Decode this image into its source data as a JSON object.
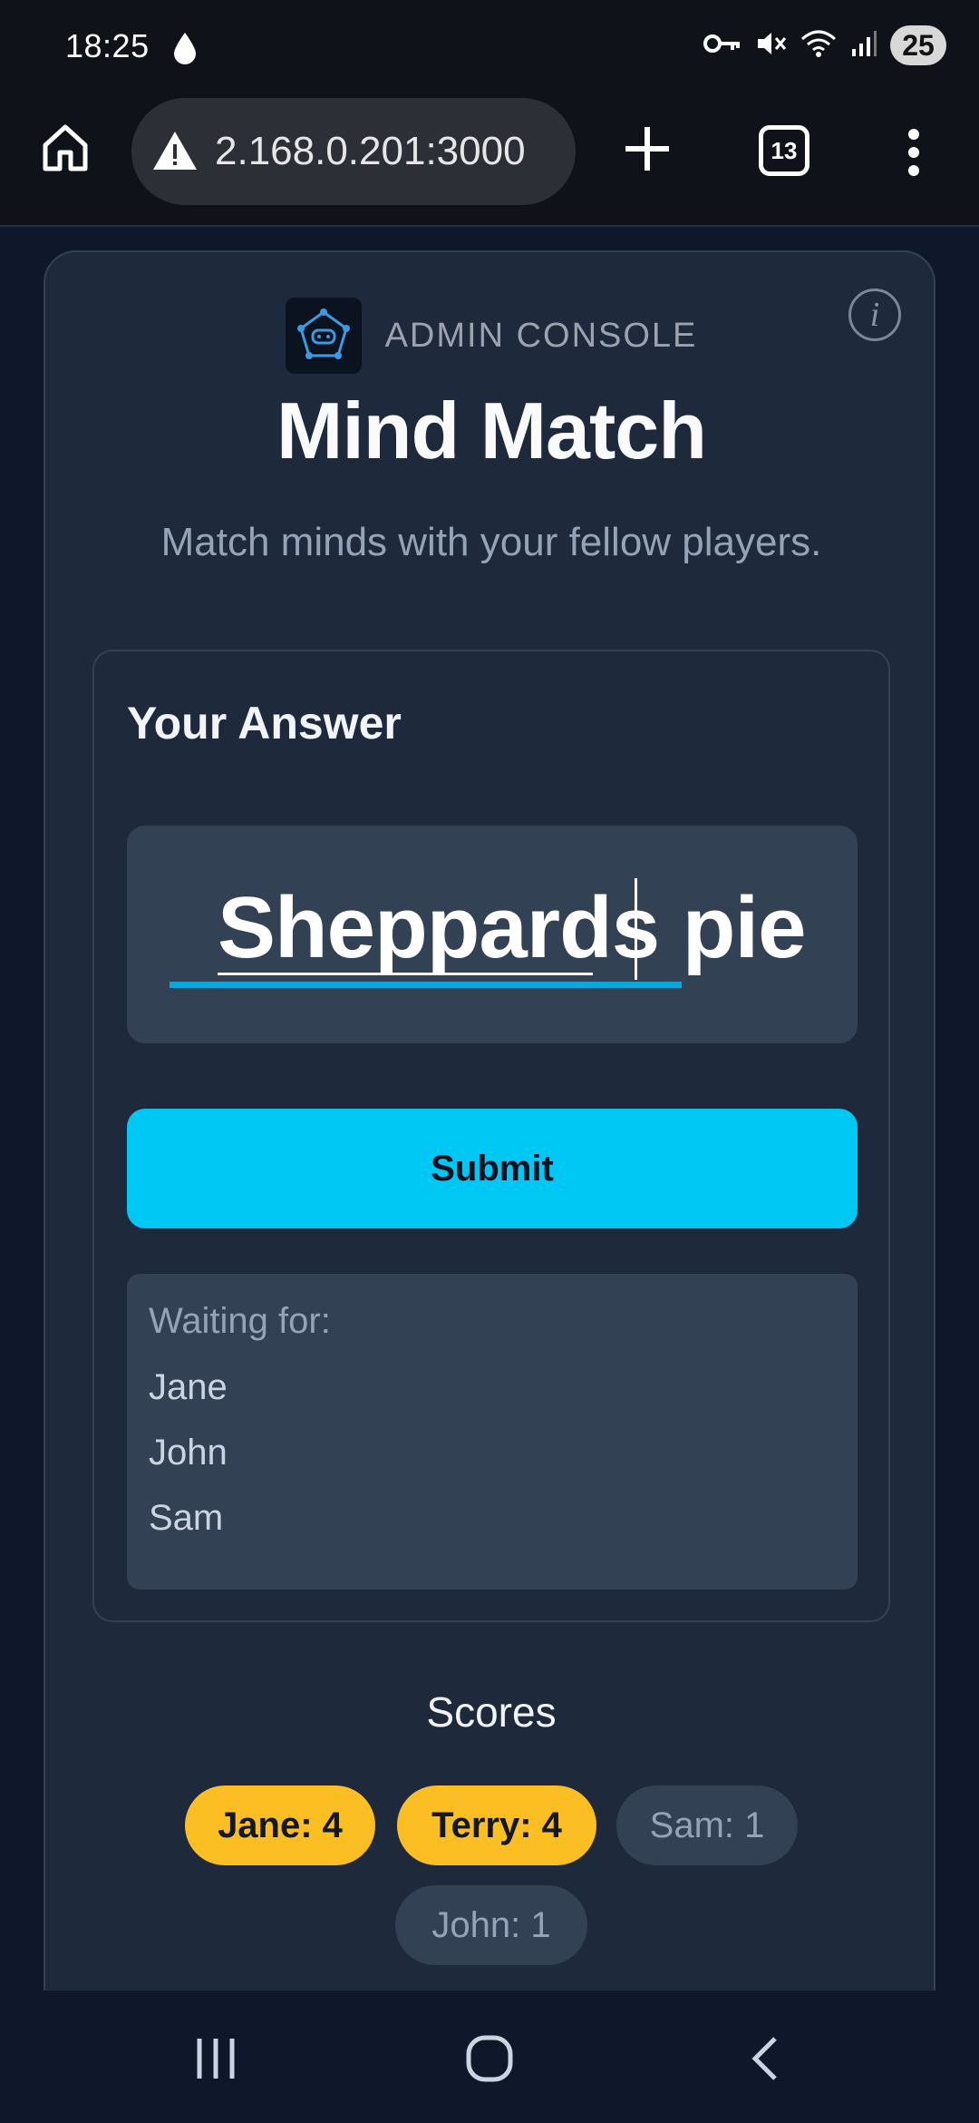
{
  "status_bar": {
    "time": "18:25",
    "battery": "25"
  },
  "browser": {
    "url": "2.168.0.201:3000",
    "tab_count": "13"
  },
  "header": {
    "admin_label": "ADMIN CONSOLE",
    "title": "Mind Match",
    "subtitle": "Match minds with your fellow players."
  },
  "answer": {
    "heading": "Your Answer",
    "value": "Sheppards pie",
    "submit_label": "Submit"
  },
  "waiting": {
    "label": "Waiting for:",
    "players": [
      "Jane",
      "John",
      "Sam"
    ]
  },
  "scores": {
    "title": "Scores",
    "entries": [
      {
        "text": "Jane: 4",
        "leader": true
      },
      {
        "text": "Terry: 4",
        "leader": true
      },
      {
        "text": "Sam: 1",
        "leader": false
      },
      {
        "text": "John: 1",
        "leader": false
      }
    ]
  },
  "colors": {
    "accent": "#00c8f5",
    "leader": "#fbbf24",
    "card": "#1e293b"
  }
}
